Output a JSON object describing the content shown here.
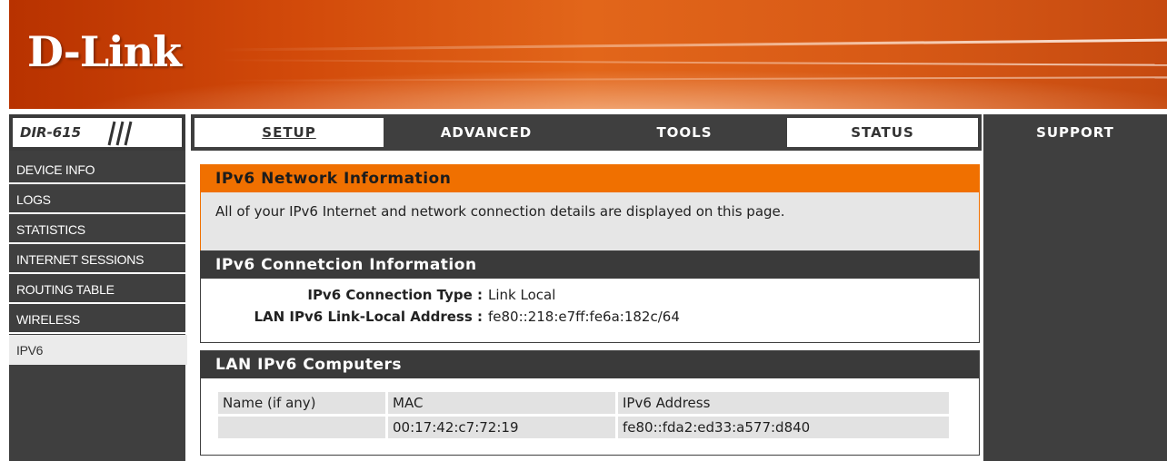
{
  "brand": {
    "logo_text": "D-Link",
    "model": "DIR-615"
  },
  "colors": {
    "accent": "#f07000",
    "nav_dark": "#3f3f3f",
    "banner": "#d24a0a"
  },
  "nav": {
    "tabs": [
      {
        "label": "SETUP",
        "style": "light"
      },
      {
        "label": "ADVANCED",
        "style": "dark"
      },
      {
        "label": "TOOLS",
        "style": "dark"
      },
      {
        "label": "STATUS",
        "style": "light"
      },
      {
        "label": "SUPPORT",
        "style": "dark"
      }
    ]
  },
  "sidebar": {
    "items": [
      {
        "label": "DEVICE INFO"
      },
      {
        "label": "LOGS"
      },
      {
        "label": "STATISTICS"
      },
      {
        "label": "INTERNET SESSIONS"
      },
      {
        "label": "ROUTING TABLE"
      },
      {
        "label": "WIRELESS"
      },
      {
        "label": "IPV6",
        "active": true
      }
    ]
  },
  "intro": {
    "title": "IPv6 Network Information",
    "text": "All of your IPv6 Internet and network connection details are displayed on this page."
  },
  "connection": {
    "title": "IPv6 Connetcion Information",
    "type_label": "IPv6 Connection Type :",
    "type_value": "Link Local",
    "lla_label": "LAN IPv6 Link-Local Address :",
    "lla_value": "fe80::218:e7ff:fe6a:182c/64"
  },
  "computers": {
    "title": "LAN IPv6 Computers",
    "columns": [
      "Name (if any)",
      "MAC",
      "IPv6 Address"
    ],
    "rows": [
      [
        "",
        "00:17:42:c7:72:19",
        "fe80::fda2:ed33:a577:d840"
      ]
    ]
  }
}
